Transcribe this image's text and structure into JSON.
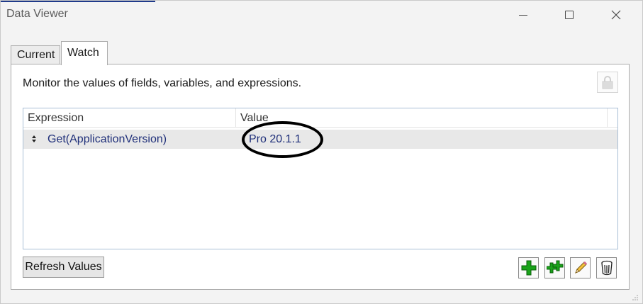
{
  "window": {
    "title": "Data Viewer"
  },
  "tabs": [
    {
      "label": "Current",
      "selected": false
    },
    {
      "label": "Watch",
      "selected": true
    }
  ],
  "watch_panel": {
    "description": "Monitor the values of fields, variables, and expressions.",
    "columns": [
      "Expression",
      "Value"
    ],
    "rows": [
      {
        "expression": "Get(ApplicationVersion)",
        "value": "Pro 20.1.1"
      }
    ],
    "refresh_label": "Refresh Values"
  },
  "toolbar": {
    "icons": [
      "add-expression-icon",
      "add-multiple-icon",
      "edit-expression-icon",
      "delete-expression-icon"
    ]
  },
  "colors": {
    "accent": "#1f3a8a",
    "value_text": "#20307a",
    "add_green": "#1aa31a"
  }
}
